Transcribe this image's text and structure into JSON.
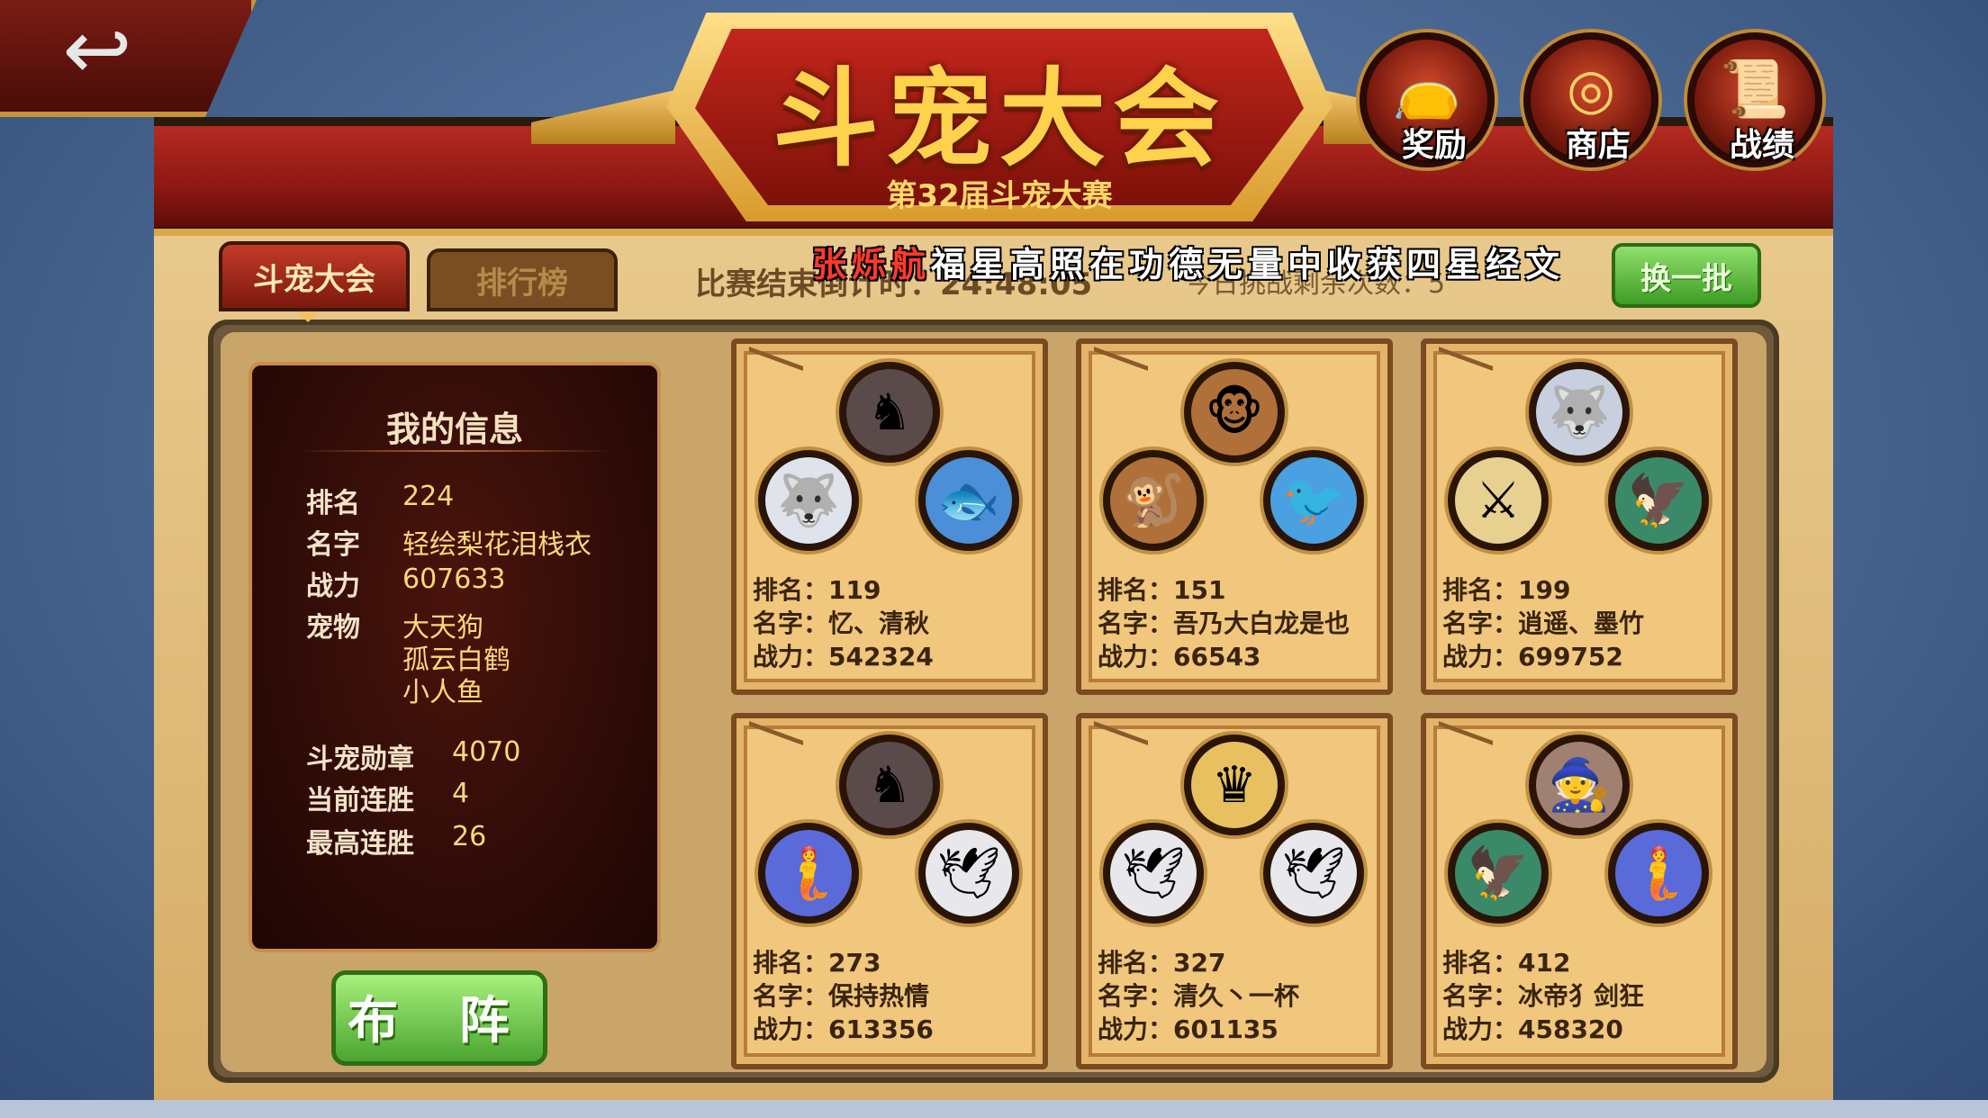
{
  "header": {
    "title": "斗宠大会",
    "subtitle": "第32届斗宠大赛",
    "back_icon": "back-arrow-icon",
    "icons": [
      {
        "label": "奖励",
        "icon": "reward-bag-icon"
      },
      {
        "label": "商店",
        "icon": "coin-shop-icon"
      },
      {
        "label": "战绩",
        "icon": "scroll-record-icon"
      }
    ]
  },
  "tabs": {
    "active": "斗宠大会",
    "ranking": "排行榜"
  },
  "countdown_text": "比赛结束倒计时：24:48:05",
  "ticker": {
    "player": "张烁航",
    "message": "福星高照在功德无量中收获四星经文"
  },
  "challenge_text": "今日挑战剩余次数：5",
  "refresh_label": "换一批",
  "my_info": {
    "title": "我的信息",
    "rank_label": "排名",
    "rank": "224",
    "name_label": "名字",
    "name": "轻绘梨花泪栈衣",
    "power_label": "战力",
    "power": "607633",
    "pets_label": "宠物",
    "pets": [
      "大天狗",
      "孤云白鹤",
      "小人鱼"
    ],
    "medal_label": "斗宠勋章",
    "medal": "4070",
    "streak_label": "当前连胜",
    "streak": "4",
    "best_label": "最高连胜",
    "best": "26"
  },
  "deploy_label": "布 阵",
  "opponents": [
    {
      "rank": "排名：119",
      "name": "名字：忆、清秋",
      "power": "战力：542324",
      "pets": [
        "dark-horse-icon",
        "white-wolf-icon",
        "blue-fish-icon"
      ]
    },
    {
      "rank": "排名：151",
      "name": "名字：吾乃大白龙是也",
      "power": "战力：66543",
      "pets": [
        "monkey-icon",
        "monkey-icon",
        "blue-bird-icon"
      ]
    },
    {
      "rank": "排名：199",
      "name": "名字：逍遥、墨竹",
      "power": "战力：699752",
      "pets": [
        "wolf-beast-icon",
        "armored-warrior-icon",
        "green-eagle-icon"
      ]
    },
    {
      "rank": "排名：273",
      "name": "名字：保持热情",
      "power": "战力：613356",
      "pets": [
        "dark-horse-icon",
        "blue-mermaid-icon",
        "white-crane-icon"
      ]
    },
    {
      "rank": "排名：327",
      "name": "名字：清久丶一杯",
      "power": "战力：601135",
      "pets": [
        "golden-knight-icon",
        "white-crane-icon",
        "white-crane-icon"
      ]
    },
    {
      "rank": "排名：412",
      "name": "名字：冰帝犭剑狂",
      "power": "战力：458320",
      "pets": [
        "bearded-elder-icon",
        "green-eagle-icon",
        "blue-mermaid-icon"
      ]
    }
  ]
}
